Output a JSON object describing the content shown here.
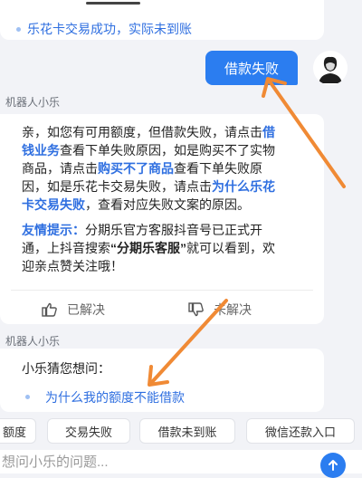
{
  "top_card": {
    "suggestion": "乐花卡交易成功，实际未到账"
  },
  "user_message": "借款失败",
  "bot_name_1": "机器人小乐",
  "answer": {
    "p1_a": "亲，如您有可用额度，但借款失败，请点击",
    "p1_link1": "借钱业务",
    "p1_b": "查看下单失败原因，如是购买不了实物商品，请点击",
    "p1_link2": "购买不了商品",
    "p1_c": "查看下单失败原因，如是乐花卡交易失败，请点击",
    "p1_link3": "为什么乐花卡交易失败",
    "p1_d": "，查看对应失败文案的原因。",
    "p2_label": "友情提示：",
    "p2_a": "分期乐官方客服抖音号已正式开通，上抖音搜索",
    "p2_bold": "“分期乐客服”",
    "p2_b": "就可以看到，欢迎亲点赞关注哦！",
    "resolved": "已解决",
    "unresolved": "未解决"
  },
  "bot_name_2": "机器人小乐",
  "guess": {
    "title": "小乐猜您想问：",
    "item": "为什么我的额度不能借款"
  },
  "quick_chips": [
    "额度",
    "交易失败",
    "借款未到账",
    "微信还款入口"
  ],
  "input": {
    "placeholder": "想问小乐的问题..."
  },
  "colors": {
    "accent": "#2b7df0",
    "link": "#2f6fe0",
    "annotation_arrow": "#f08a35"
  }
}
